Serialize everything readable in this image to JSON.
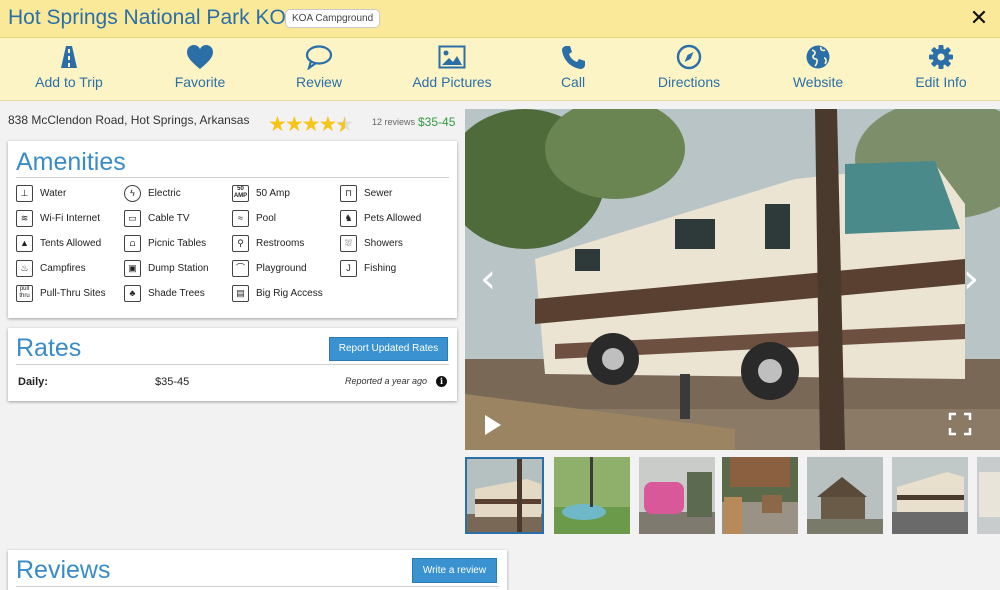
{
  "header": {
    "title": "Hot Springs National Park KOA",
    "badge": "KOA Campground",
    "close_icon": "close-icon"
  },
  "toolbar": [
    {
      "label": "Add to Trip",
      "icon": "road-icon"
    },
    {
      "label": "Favorite",
      "icon": "heart-icon"
    },
    {
      "label": "Review",
      "icon": "speech-bubble-icon"
    },
    {
      "label": "Add Pictures",
      "icon": "picture-icon"
    },
    {
      "label": "Call",
      "icon": "phone-icon"
    },
    {
      "label": "Directions",
      "icon": "compass-icon"
    },
    {
      "label": "Website",
      "icon": "globe-icon"
    },
    {
      "label": "Edit Info",
      "icon": "gear-icon"
    }
  ],
  "listing": {
    "address": "838 McClendon Road, Hot Springs, Arkansas",
    "rating": 4.5,
    "review_count": "12 reviews",
    "price_range": "$35-45"
  },
  "amenities": {
    "title": "Amenities",
    "items": [
      {
        "label": "Water",
        "icon": "water-icon"
      },
      {
        "label": "Electric",
        "icon": "electric-icon"
      },
      {
        "label": "50 Amp",
        "icon": "50-amp-icon"
      },
      {
        "label": "Sewer",
        "icon": "sewer-icon"
      },
      {
        "label": "Wi-Fi Internet",
        "icon": "wifi-icon"
      },
      {
        "label": "Cable TV",
        "icon": "tv-icon"
      },
      {
        "label": "Pool",
        "icon": "pool-icon"
      },
      {
        "label": "Pets Allowed",
        "icon": "pet-icon"
      },
      {
        "label": "Tents Allowed",
        "icon": "tent-icon"
      },
      {
        "label": "Picnic Tables",
        "icon": "picnic-table-icon"
      },
      {
        "label": "Restrooms",
        "icon": "restroom-icon"
      },
      {
        "label": "Showers",
        "icon": "shower-icon"
      },
      {
        "label": "Campfires",
        "icon": "campfire-icon"
      },
      {
        "label": "Dump Station",
        "icon": "dump-station-icon"
      },
      {
        "label": "Playground",
        "icon": "playground-icon"
      },
      {
        "label": "Fishing",
        "icon": "fishing-icon"
      },
      {
        "label": "Pull-Thru Sites",
        "icon": "pull-thru-icon"
      },
      {
        "label": "Shade Trees",
        "icon": "tree-icon"
      },
      {
        "label": "Big Rig Access",
        "icon": "big-rig-icon"
      }
    ]
  },
  "rates": {
    "title": "Rates",
    "report_button": "Report Updated Rates",
    "rows": [
      {
        "label": "Daily:",
        "value": "$35-45",
        "note": "Reported a year ago"
      }
    ]
  },
  "reviews": {
    "title": "Reviews",
    "write_button": "Write a review"
  },
  "gallery": {
    "thumbnail_count": 7,
    "active_index": 0
  },
  "colors": {
    "header_bg": "#fbe99a",
    "toolbar_bg": "#fdf4c5",
    "accent_blue": "#2b6fa8",
    "heading_blue": "#3a8cc8",
    "price_green": "#2f9a3f",
    "star_gold": "#f5c518"
  }
}
